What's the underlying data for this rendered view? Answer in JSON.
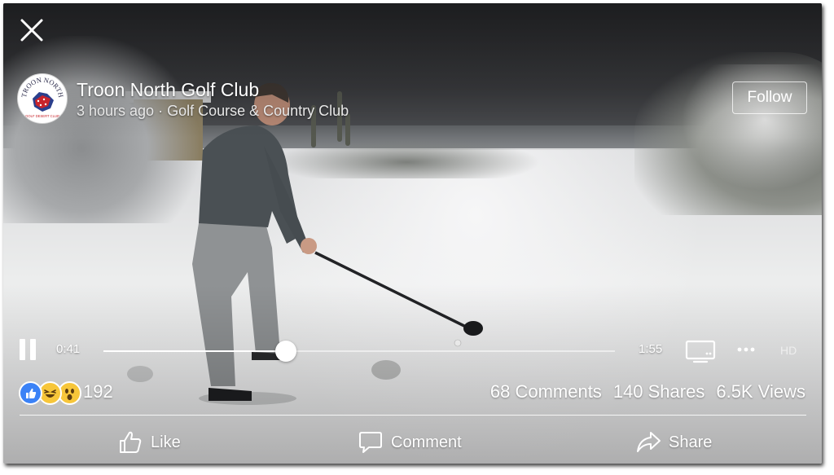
{
  "post": {
    "page_name": "Troon North Golf Club",
    "time_ago": "3 hours ago",
    "separator": " · ",
    "category": "Golf Course & Country Club",
    "avatar_text": "TROON NORTH",
    "avatar_subtext": "GOLF DESERT CLUB"
  },
  "header": {
    "close_icon": "close-icon",
    "follow_label": "Follow"
  },
  "player": {
    "current_time": "0:41",
    "duration": "1:55",
    "progress_fraction": 0.3565,
    "quality_label": "HD",
    "pause_icon": "pause-icon",
    "tv_icon": "tv-icon",
    "more_icon": "more-icon"
  },
  "stats": {
    "reaction_icons": [
      "like-reaction-icon",
      "haha-reaction-icon",
      "wow-reaction-icon"
    ],
    "reaction_count": "192",
    "comments": "68 Comments",
    "shares": "140 Shares",
    "views": "6.5K Views"
  },
  "actions": {
    "like": "Like",
    "comment": "Comment",
    "share": "Share"
  },
  "colors": {
    "like_blue": "#3b82f6",
    "emoji_yellow": "#f7c63a",
    "overlay_text": "#ffffff"
  }
}
